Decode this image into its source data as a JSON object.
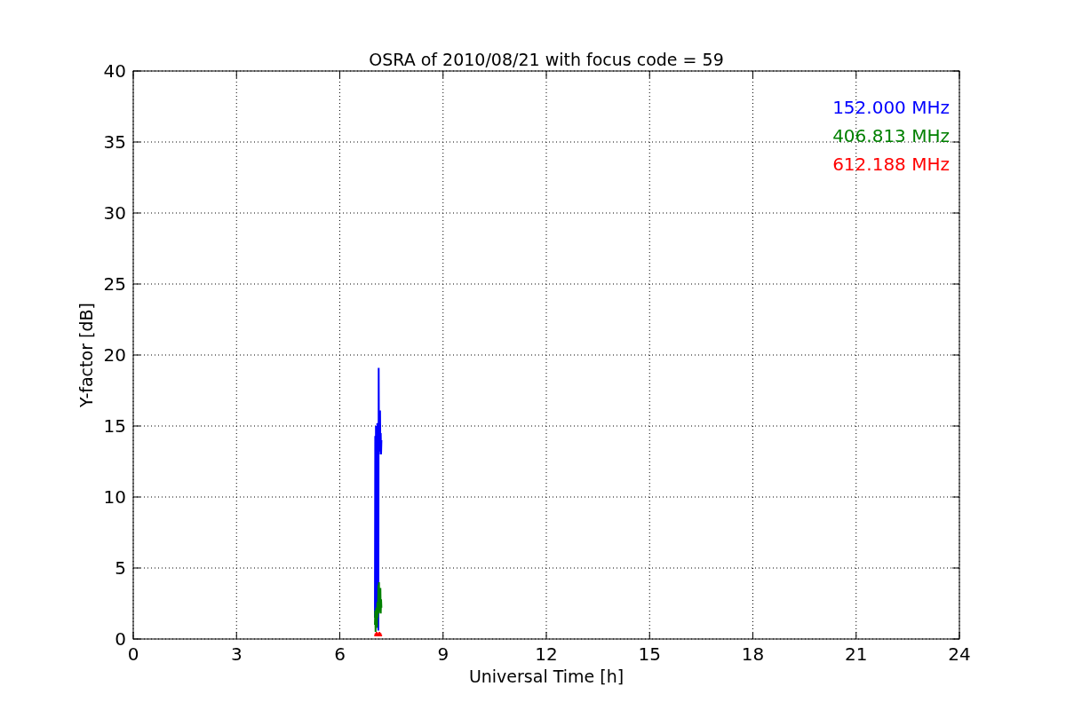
{
  "figure": {
    "chart_data": {
      "type": "line",
      "title": "OSRA of 2010/08/21 with focus code = 59",
      "xlabel": "Universal Time [h]",
      "ylabel": "Y-factor [dB]",
      "x": [
        7.02,
        7.03,
        7.04,
        7.05,
        7.06,
        7.07,
        7.08,
        7.09,
        7.1,
        7.11,
        7.12,
        7.13,
        7.14,
        7.15,
        7.16,
        7.17,
        7.18,
        7.19,
        7.2,
        7.21
      ],
      "series": [
        {
          "name": "152.000 MHz",
          "color": "#0000ff",
          "values": [
            1.5,
            14.3,
            2.0,
            15.0,
            8.8,
            14.8,
            0.8,
            15.2,
            12.5,
            14.6,
            0.6,
            19.1,
            13.0,
            15.0,
            13.5,
            16.1,
            13.2,
            14.5,
            13.0,
            14.0
          ]
        },
        {
          "name": "406.813 MHz",
          "color": "#008000",
          "values": [
            1.0,
            2.0,
            0.5,
            1.6,
            2.2,
            1.0,
            0.8,
            2.6,
            1.5,
            2.3,
            3.8,
            1.8,
            4.0,
            2.0,
            3.2,
            1.9,
            3.6,
            1.8,
            2.8,
            2.2
          ]
        },
        {
          "name": "612.188 MHz",
          "color": "#ff0000",
          "values": [
            0.3,
            0.2,
            0.4,
            0.2,
            0.3,
            0.5,
            0.2,
            0.3,
            0.4,
            0.2,
            0.3,
            0.4,
            0.3,
            0.5,
            0.2,
            0.3,
            0.4,
            0.3,
            0.2,
            0.3
          ]
        }
      ],
      "grid": true,
      "xlim": [
        0,
        24
      ],
      "ylim": [
        0,
        40
      ],
      "xticks": [
        0,
        3,
        6,
        9,
        12,
        15,
        18,
        21,
        24
      ],
      "yticks": [
        0,
        5,
        10,
        15,
        20,
        25,
        30,
        35,
        40
      ]
    }
  }
}
